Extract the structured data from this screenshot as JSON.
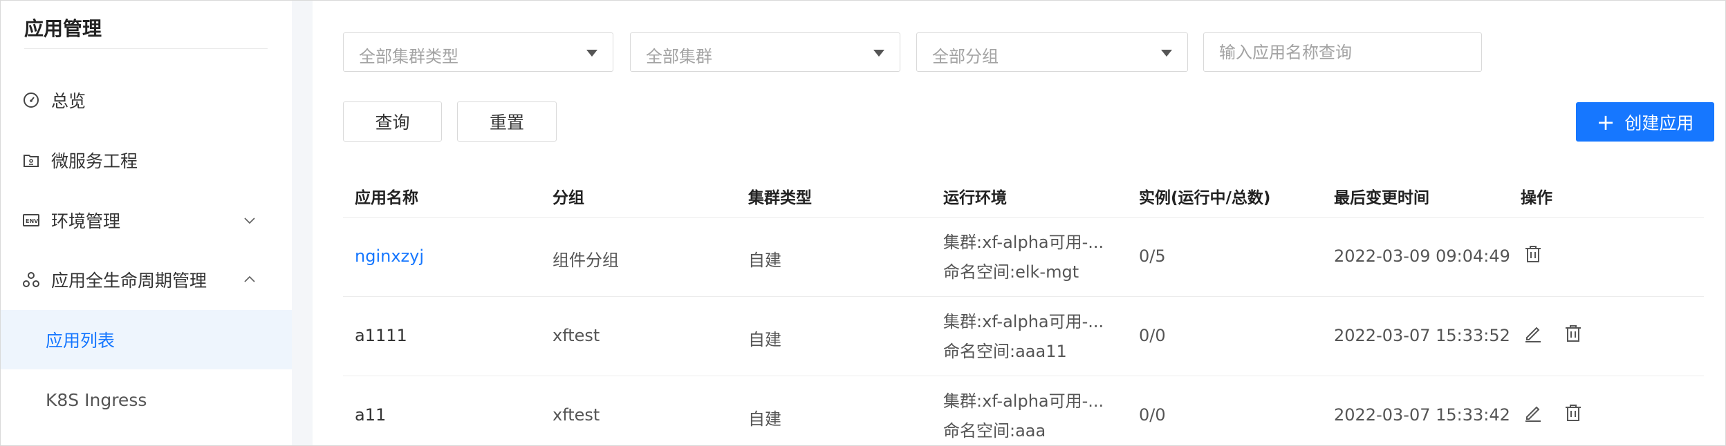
{
  "sidebar": {
    "title": "应用管理",
    "items": [
      {
        "label": "总览",
        "icon": "dashboard-icon"
      },
      {
        "label": "微服务工程",
        "icon": "project-icon"
      },
      {
        "label": "环境管理",
        "icon": "env-icon",
        "chevron": "down"
      },
      {
        "label": "应用全生命周期管理",
        "icon": "lifecycle-icon",
        "chevron": "up"
      },
      {
        "label": "应用列表",
        "active": true
      },
      {
        "label": "K8S Ingress"
      }
    ]
  },
  "filters": {
    "cluster_type_placeholder": "全部集群类型",
    "cluster_placeholder": "全部集群",
    "group_placeholder": "全部分组",
    "search_placeholder": "输入应用名称查询"
  },
  "actions": {
    "query_label": "查询",
    "reset_label": "重置",
    "create_label": "创建应用",
    "primary_color": "#1677ff"
  },
  "table": {
    "headers": [
      "应用名称",
      "分组",
      "集群类型",
      "运行环境",
      "实例(运行中/总数)",
      "最后变更时间",
      "操作"
    ],
    "rows": [
      {
        "name": "nginxzyj",
        "group": "组件分组",
        "cluster_type": "自建",
        "env_cluster": "集群:xf-alpha可用-...",
        "env_ns": "命名空间:elk-mgt",
        "instances": "0/5",
        "updated": "2022-03-09 09:04:49",
        "actions": [
          "delete"
        ]
      },
      {
        "name": "a1111",
        "group": "xftest",
        "cluster_type": "自建",
        "env_cluster": "集群:xf-alpha可用-...",
        "env_ns": "命名空间:aaa11",
        "instances": "0/0",
        "updated": "2022-03-07 15:33:52",
        "actions": [
          "edit",
          "delete"
        ]
      },
      {
        "name": "a11",
        "group": "xftest",
        "cluster_type": "自建",
        "env_cluster": "集群:xf-alpha可用-...",
        "env_ns": "命名空间:aaa",
        "instances": "0/0",
        "updated": "2022-03-07 15:33:42",
        "actions": [
          "edit",
          "delete"
        ]
      }
    ]
  }
}
